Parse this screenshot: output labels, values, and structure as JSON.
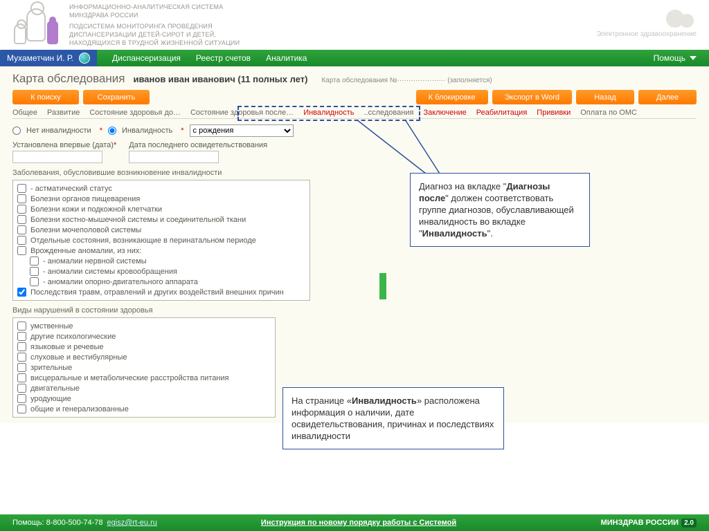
{
  "header": {
    "sysline1": "ИНФОРМАЦИОННО-АНАЛИТИЧЕСКАЯ СИСТЕМА",
    "sysline2": "МИНЗДРАВА РОССИИ",
    "sysline3": "ПОДСИСТЕМА МОНИТОРИНГА ПРОВЕДЕНИЯ",
    "sysline4": "ДИСПАНСЕРИЗАЦИИ ДЕТЕЙ-СИРОТ И ДЕТЕЙ,",
    "sysline5": "НАХОДЯЩИХСЯ В ТРУДНОЙ ЖИЗНЕННОЙ СИТУАЦИИ",
    "ehealth": "Электронное здравоохранение"
  },
  "nav": {
    "user": "Мухаметчин И. Р.",
    "links": [
      "Диспансеризация",
      "Реестр счетов",
      "Аналитика"
    ],
    "help": "Помощь"
  },
  "title": {
    "page": "Карта обследования",
    "patient": "иванов иван иванович (11 полных лет)",
    "cardno": "Карта обследования №····················· (заполняется)"
  },
  "buttons": {
    "search": "К поиску",
    "save": "Сохранить",
    "block": "К блокировке",
    "export": "Экспорт в Word",
    "back": "Назад",
    "next": "Далее"
  },
  "tabs": [
    "Общее",
    "Развитие",
    "Состояние здоровья до…",
    "Состояние здоровья после…",
    "Инвалидность",
    "..сследования",
    "Заключение",
    "Реабилитация",
    "Прививки",
    "Оплата по ОМС"
  ],
  "form": {
    "noinv": "Нет инвалидности",
    "inv": "Инвалидность",
    "since": "с рождения",
    "firstdate": "Установлена впервые (дата)",
    "lastdate": "Дата последнего освидетельствования",
    "diseases_title": "Заболевания, обусловившие возникновение инвалидности",
    "diseases": [
      "- астматический статус",
      "Болезни органов пищеварения",
      "Болезни кожи и подкожной клетчатки",
      "Болезни костно-мышечной системы и соединительной ткани",
      "Болезни мочеполовой системы",
      "Отдельные состояния, возникающие в перинатальном периоде",
      "Врожденные аномалии, из них:",
      "- аномалии нервной системы",
      "- аномалии системы кровообращения",
      "- аномалии опорно-двигательного аппарата",
      "Последствия травм, отравлений и других воздействий внешних причин"
    ],
    "viol_title": "Виды нарушений в состоянии здоровья",
    "violations": [
      "умственные",
      "другие психологические",
      "языковые и речевые",
      "слуховые и вестибулярные",
      "зрительные",
      "висцеральные и метаболические расстройства питания",
      "двигательные",
      "уродующие",
      "общие и генерализованные"
    ]
  },
  "callouts": {
    "c1a": "Диагноз на вкладке \"",
    "c1b": "Диагнозы после",
    "c1c": "\" должен соответствовать группе диагнозов, обуславливающей инвалидность во вкладке \"",
    "c1d": "Инвалидность",
    "c1e": "\".",
    "c2a": "На странице «",
    "c2b": "Инвалидность",
    "c2c": "» расположена информация о наличии, дате освидетельствования, причинах и последствиях инвалидности"
  },
  "footer": {
    "help": "Помощь: 8-800-500-74-78",
    "email": "egisz@rt-eu.ru",
    "mid": "Инструкция по новому порядку работы с Системой",
    "brand": "МИНЗДРАВ РОССИИ",
    "ver": "2.0"
  }
}
